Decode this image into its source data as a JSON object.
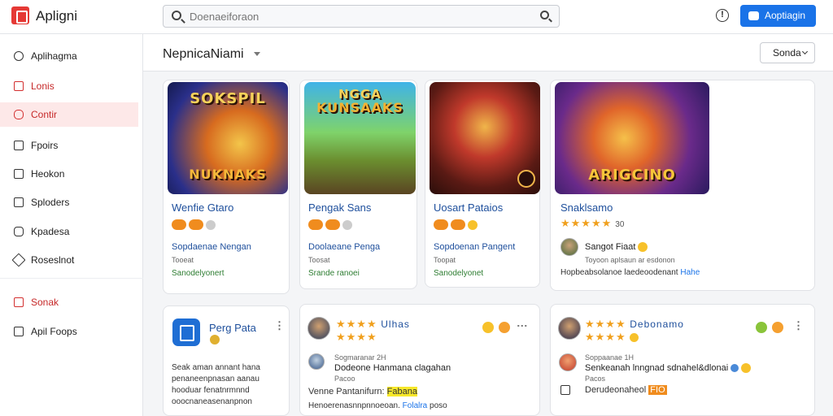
{
  "app": {
    "title": "Apligni"
  },
  "search": {
    "placeholder": "Doenaeiforaon"
  },
  "header": {
    "action_label": "Aoptiagin"
  },
  "sidebar": {
    "items": [
      {
        "label": "Aplihagma"
      },
      {
        "label": "Lonis"
      },
      {
        "label": "Contir"
      },
      {
        "label": "Fpoirs"
      },
      {
        "label": "Heokon"
      },
      {
        "label": "Sploders"
      },
      {
        "label": "Kpadesa"
      },
      {
        "label": "Roseslnot"
      },
      {
        "label": "Sonak"
      },
      {
        "label": "Apil Foops"
      }
    ]
  },
  "page": {
    "title": "NepnicaNiami",
    "sort_label": "Sonda"
  },
  "games": [
    {
      "art_text": "SOKSPIL",
      "art_sub": "NUKNAKS",
      "title": "Wenfie Gtaro",
      "meta1": "Sopdaenae Nengan",
      "meta2": "Tooeat",
      "meta3": "Sanodelyonert"
    },
    {
      "art_text": "NGGA",
      "art_sub": "KUNSAAKS",
      "title": "Pengak Sans",
      "meta1": "Doolaeane Penga",
      "meta2": "Toosat",
      "meta3": "Srande ranoei"
    },
    {
      "title": "Uosart Pataios",
      "meta1": "Sopdoenan Pangent",
      "meta2": "Toopat",
      "meta3": "Sanodelyonet"
    },
    {
      "art_text": "ARIGCINO",
      "title": "Snaklsamo",
      "rating": "30",
      "reviewer": "Sangot Fiaat",
      "meta2": "Toyoon aplsaun ar esdonon",
      "review": "Hopbeabsolanoe laedeoodenant",
      "review_link": "Hahe"
    }
  ],
  "reviews": [
    {
      "app_name": "Perg Pata",
      "body": [
        "Seak aman annant hana",
        "penaneenpnasan aanau",
        "hooduar fenatnrmnnd",
        "ooocnaneasenanpnon"
      ]
    },
    {
      "header": "Ulhas",
      "reviewer": "Dodeone Hanmana clagahan",
      "date_pre": "Sogmaranar 2H",
      "date": "Pacoo",
      "line1": "Venne Pantanifurn:",
      "line1_hl": "Fabana",
      "line2": "Henoerenasnnpnnoeoan.",
      "line2_link": "Folalra",
      "line2_tail": "poso"
    },
    {
      "header": "Debonamo",
      "reviewer": "Senkeanah lnngnad sdnahel&dlonai",
      "date_pre": "Soppaanae 1H",
      "date": "Pacos",
      "line1": "Derudeonaheol",
      "line1_hl": "FIO"
    }
  ],
  "colors": {
    "accent": "#1a73e8",
    "brand": "#e53935",
    "star": "#f0a01e"
  }
}
